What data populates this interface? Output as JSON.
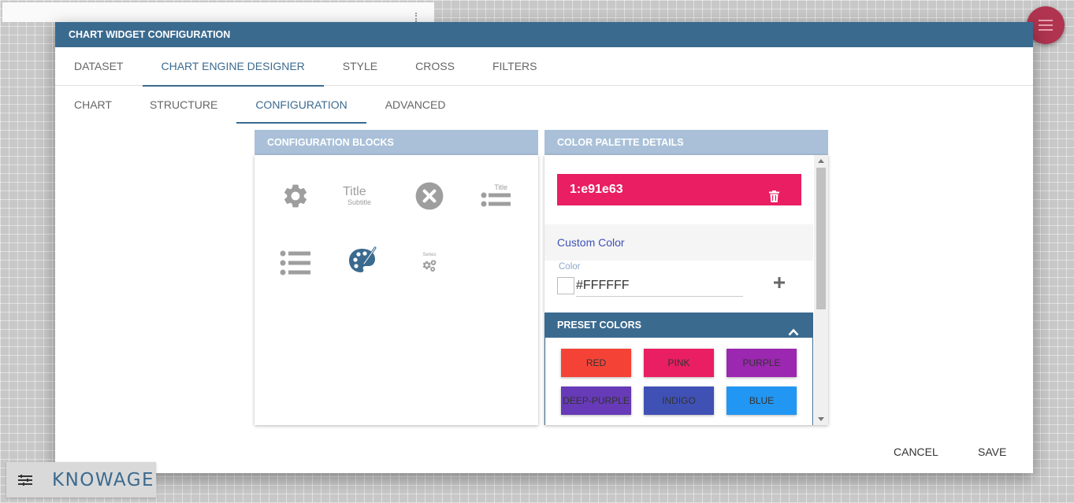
{
  "dialog": {
    "title": "CHART WIDGET CONFIGURATION"
  },
  "tabs": [
    {
      "label": "DATASET"
    },
    {
      "label": "CHART ENGINE DESIGNER",
      "active": true
    },
    {
      "label": "STYLE"
    },
    {
      "label": "CROSS"
    },
    {
      "label": "FILTERS"
    }
  ],
  "subtabs": [
    {
      "label": "CHART"
    },
    {
      "label": "STRUCTURE"
    },
    {
      "label": "CONFIGURATION",
      "active": true
    },
    {
      "label": "ADVANCED"
    }
  ],
  "config_blocks": {
    "title": "CONFIGURATION BLOCKS",
    "icons": {
      "gear": "gear-icon",
      "title": "title-subtitle-icon",
      "close": "close-circle-icon",
      "legend": "legend-title-icon",
      "list": "list-icon",
      "palette": "palette-icon",
      "series": "series-settings-icon"
    },
    "title_icon_text": "Title",
    "subtitle_icon_text": "Subtitle",
    "legend_icon_text": "Title",
    "series_icon_text": "Series"
  },
  "palette": {
    "title": "COLOR PALETTE DETAILS",
    "entries": [
      {
        "label": "1:e91e63",
        "color": "#e91e63"
      }
    ],
    "custom_color_label": "Custom Color",
    "color_field_label": "Color",
    "color_value": "#FFFFFF",
    "preset_title": "PRESET COLORS",
    "presets": [
      {
        "label": "RED",
        "color": "#f44336"
      },
      {
        "label": "PINK",
        "color": "#e91e63"
      },
      {
        "label": "PURPLE",
        "color": "#9c27b0"
      },
      {
        "label": "DEEP-PURPLE",
        "color": "#673ab7"
      },
      {
        "label": "INDIGO",
        "color": "#3f51b5"
      },
      {
        "label": "BLUE",
        "color": "#2196f3"
      }
    ]
  },
  "footer": {
    "cancel": "CANCEL",
    "save": "SAVE"
  },
  "brand": {
    "name": "KNOWAGE"
  },
  "colors": {
    "primary": "#3b6a8f",
    "panel_header": "#a9c0d8",
    "fab": "#b0344f"
  }
}
